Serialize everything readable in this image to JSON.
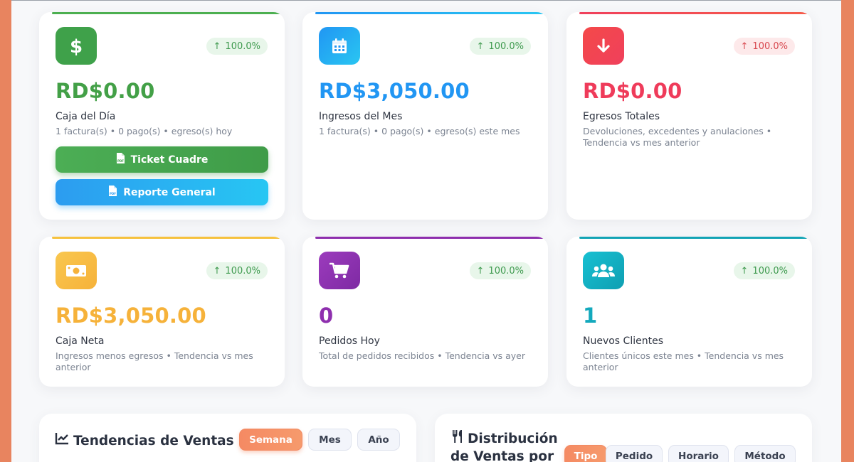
{
  "cards": [
    {
      "value": "RD$0.00",
      "label": "Caja del Día",
      "desc": "1 factura(s) • 0 pago(s) • egreso(s) hoy",
      "trend": "100.0%",
      "trend_dir": "up",
      "icon": "dollar-icon",
      "accent": "#4caf50"
    },
    {
      "value": "RD$3,050.00",
      "label": "Ingresos del Mes",
      "desc": "1 factura(s) • 0 pago(s) • egreso(s) este mes",
      "trend": "100.0%",
      "trend_dir": "up",
      "icon": "calendar-icon",
      "accent": "#2196f3"
    },
    {
      "value": "RD$0.00",
      "label": "Egresos Totales",
      "desc": "Devoluciones, excedentes y anulaciones • Tendencia vs mes anterior",
      "trend": "100.0%",
      "trend_dir": "down",
      "icon": "arrow-down-icon",
      "accent": "#f0405c"
    },
    {
      "value": "RD$3,050.00",
      "label": "Caja Neta",
      "desc": "Ingresos menos egresos • Tendencia vs mes anterior",
      "trend": "100.0%",
      "trend_dir": "up",
      "icon": "money-bill-icon",
      "accent": "#f6b23a"
    },
    {
      "value": "0",
      "label": "Pedidos Hoy",
      "desc": "Total de pedidos recibidos • Tendencia vs ayer",
      "trend": "100.0%",
      "trend_dir": "up",
      "icon": "cart-icon",
      "accent": "#8e2fae"
    },
    {
      "value": "1",
      "label": "Nuevos Clientes",
      "desc": "Clientes únicos este mes • Tendencia vs mes anterior",
      "trend": "100.0%",
      "trend_dir": "up",
      "icon": "users-icon",
      "accent": "#13b3c8"
    }
  ],
  "buttons": {
    "ticket": "Ticket Cuadre",
    "report": "Reporte General"
  },
  "sales_trends": {
    "title": "Tendencias de Ventas",
    "tabs": [
      "Semana",
      "Mes",
      "Año"
    ],
    "active": "Semana"
  },
  "sales_dist": {
    "title_line1": "Distribución",
    "title_line2": "de Ventas por",
    "tabs": [
      "Tipo",
      "Pedido",
      "Horario",
      "Método"
    ],
    "active": "Tipo"
  }
}
